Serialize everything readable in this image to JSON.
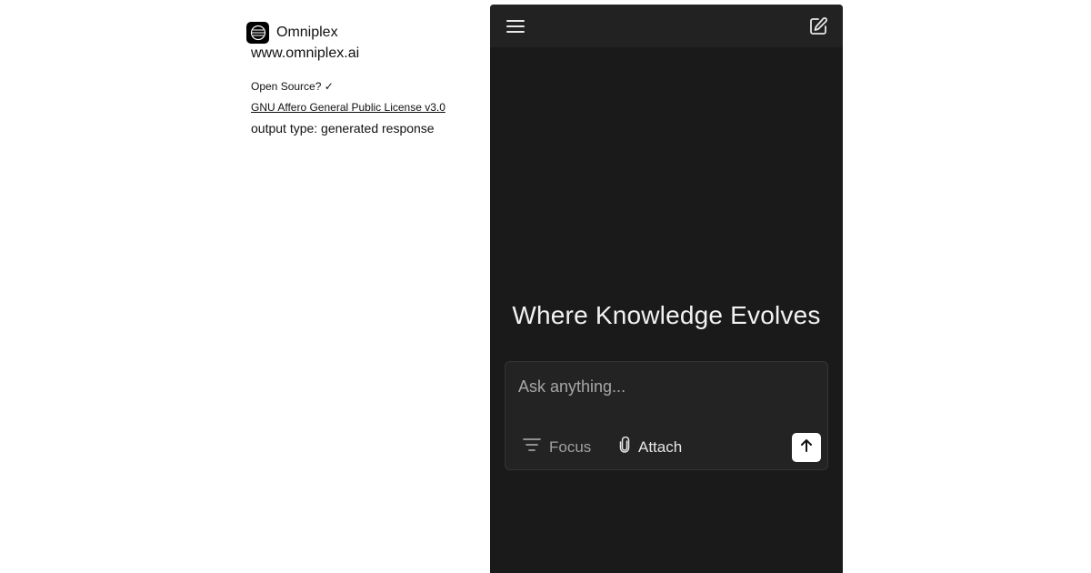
{
  "info": {
    "app_name": "Omniplex",
    "app_url": "www.omniplex.ai",
    "open_source": "Open Source? ✓",
    "license": "GNU Affero General Public License v3.0",
    "output_type": "output type: generated response"
  },
  "app": {
    "headline": "Where Knowledge Evolves",
    "ask_placeholder": "Ask anything...",
    "focus_label": "Focus",
    "attach_label": "Attach"
  },
  "icons": {
    "logo": "omniplex-logo-icon",
    "menu": "hamburger-menu-icon",
    "edit": "edit-note-icon",
    "focus": "filter-lines-icon",
    "attach": "paperclip-icon",
    "send": "arrow-up-icon"
  },
  "colors": {
    "app_background": "#1a1a1a",
    "topbar": "#222222",
    "input_box": "#232323",
    "send_button": "#ffffff"
  }
}
